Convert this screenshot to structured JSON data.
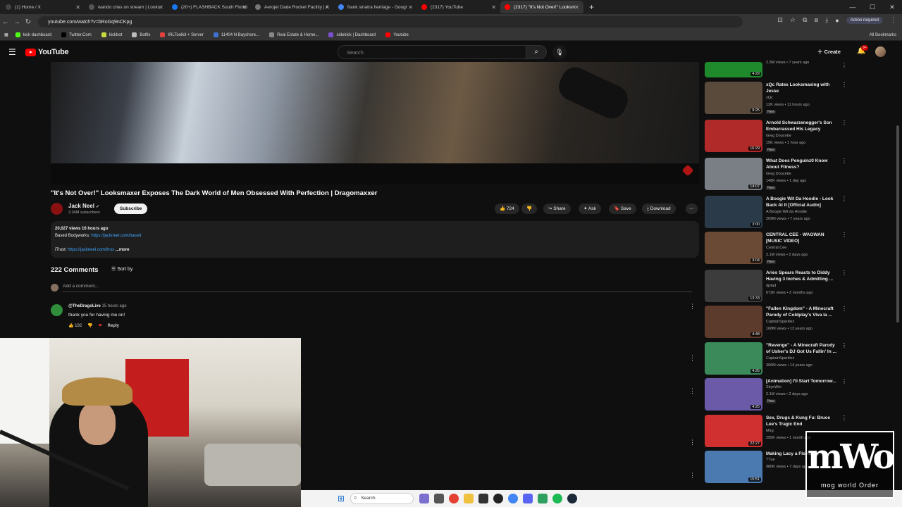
{
  "browser": {
    "tabs": [
      {
        "title": "(1) Home / X",
        "color": "#111111"
      },
      {
        "title": "wando cries on stream | Looks",
        "color": "#222222"
      },
      {
        "title": "(20+) FLASHBACK South Floridi",
        "color": "#1877f2"
      },
      {
        "title": "Aerojet Dade Rocket Facility | A",
        "color": "#666666"
      },
      {
        "title": "frank sinatra heritage - Googl",
        "color": "#4285f4"
      },
      {
        "title": "(2317) YouTube",
        "color": "#ff0000"
      },
      {
        "title": "(2317) \"It's Not Over!\" Looksm",
        "color": "#ff0000"
      }
    ],
    "url": "youtube.com/watch?v=bRoGq9nCKpg",
    "action_required": "Action required",
    "bookmarks": [
      "kick dashboard",
      "Twitter.Com",
      "kickbot",
      "Botfix",
      "IRLToolkit + Server",
      "11404 N Bayshore...",
      "Real Estate & Home...",
      "sidekick | Dashboard",
      "Youtube"
    ],
    "all_bookmarks": "All Bookmarks"
  },
  "youtube": {
    "logo": "YouTube",
    "search_placeholder": "Search",
    "create_label": "Create",
    "notif_badge": "9+"
  },
  "video": {
    "title": "\"It's Not Over!\" Looksmaxer Exposes The Dark World of Men Obsessed With Perfection | Dragomaxxer",
    "channel": "Jack Neel",
    "subscribers": "3.34M subscribers",
    "subscribe_label": "Subscribe",
    "likes": "724",
    "share_label": "Share",
    "ask_label": "Ask",
    "save_label": "Save",
    "download_label": "Download",
    "views_age": "20,027 views  16 hours ago",
    "desc_line1_label": "Based Bodyworks:",
    "desc_line1_link": "https://jackneel.com/based",
    "desc_line2_label": "iTrust:",
    "desc_line2_link": "https://jackneel.com/itrus",
    "more": "...more"
  },
  "comments": {
    "count": "222 Comments",
    "sort_label": "Sort by",
    "add_placeholder": "Add a comment...",
    "items": [
      {
        "author": "@TheDragoLive",
        "age": "15 hours ago",
        "text": "thank you for having me on!",
        "likes": "192",
        "reply": "Reply"
      }
    ]
  },
  "taskbar": {
    "search": "Search"
  },
  "recommendations": [
    {
      "title": "",
      "channel": "",
      "meta": "2.3M views • 7 years ago",
      "duration": "4:29",
      "new": false,
      "thumb": "#1f8a2c"
    },
    {
      "title": "xQc Rates Looksmaxing with Jesse",
      "channel": "xQc",
      "meta": "12K views • 11 hours ago",
      "duration": "9:25",
      "new": true,
      "thumb": "#5a4a3c"
    },
    {
      "title": "Arnold Schwarzenegger's Son Embarrassed His Legacy",
      "channel": "Greg Doucette",
      "meta": "15K views • 1 hour ago",
      "duration": "16:29",
      "new": true,
      "thumb": "#b02a2a"
    },
    {
      "title": "What Does Penguinz0 Know About Fitness?",
      "channel": "Greg Doucette",
      "meta": "148K views • 1 day ago",
      "duration": "14:07",
      "new": true,
      "thumb": "#7a7f86"
    },
    {
      "title": "A Boogie Wit Da Hoodie - Look Back At It [Official Audio]",
      "channel": "A Boogie Wit da Hoodie",
      "meta": "209M views • 7 years ago",
      "duration": "3:00",
      "new": false,
      "thumb": "#2a3a48"
    },
    {
      "title": "CENTRAL CEE - WAGWAN [MUSIC VIDEO]",
      "channel": "Central Cee",
      "meta": "2.1M views • 2 days ago",
      "duration": "3:04",
      "new": true,
      "thumb": "#6a4a34"
    },
    {
      "title": "Aries Spears Reacts to Diddy Having 3 Inches & Admitting ...",
      "channel": "djvlad",
      "meta": "672K views • 2 months ago",
      "duration": "13:33",
      "new": false,
      "thumb": "#3c3c3c"
    },
    {
      "title": "\"Fallen Kingdom\" - A Minecraft Parody of Coldplay's Viva la ...",
      "channel": "CaptainSparklez",
      "meta": "168M views • 13 years ago",
      "duration": "4:48",
      "new": false,
      "thumb": "#5c3a2c"
    },
    {
      "title": "\"Revenge\" - A Minecraft Parody of Usher's DJ Got Us Fallin' In ...",
      "channel": "CaptainSparklez",
      "meta": "306M views • 14 years ago",
      "duration": "4:25",
      "new": false,
      "thumb": "#3a8a5a"
    },
    {
      "title": "[Animation] I'll Start Tomorrow...",
      "channel": "SkyeWei",
      "meta": "2.1M views • 2 days ago",
      "duration": "4:25",
      "new": true,
      "thumb": "#6a5aa8"
    },
    {
      "title": "Sex, Drugs & Kung Fu: Bruce Lee's Tragic End",
      "channel": "Mirg",
      "meta": "295K views • 1 month ago",
      "duration": "22:27",
      "new": false,
      "thumb": "#d03030"
    },
    {
      "title": "Making Lacy a Florida ...",
      "channel": "TTue",
      "meta": "980K views • 7 days ago",
      "duration": "15:51",
      "new": false,
      "thumb": "#4a7ab0"
    }
  ],
  "watermark": {
    "big": "mWo",
    "small": "mog world Order"
  }
}
